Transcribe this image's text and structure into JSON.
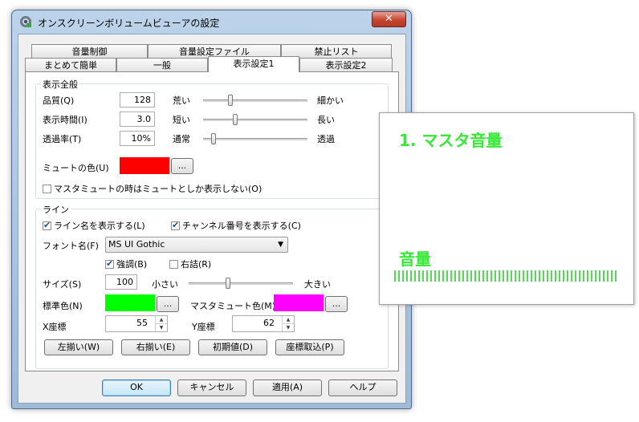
{
  "window": {
    "title": "オンスクリーンボリュームビューアの設定",
    "close_label": "✕"
  },
  "tabs": {
    "row1": [
      "音量制御",
      "音量設定ファイル",
      "禁止リスト"
    ],
    "row2": [
      "まとめて簡単",
      "一般",
      "表示設定1",
      "表示設定2"
    ],
    "active": "表示設定1"
  },
  "general": {
    "group_label": "表示全般",
    "quality": {
      "label": "品質(Q)",
      "value": "128",
      "low": "荒い",
      "high": "細かい",
      "level": 0.26
    },
    "display_time": {
      "label": "表示時間(I)",
      "value": "3.0",
      "low": "短い",
      "high": "長い",
      "level": 0.31
    },
    "transparency": {
      "label": "透過率(T)",
      "value": "10%",
      "low": "通常",
      "high": "透過",
      "level": 0.1
    },
    "mute_color": {
      "label": "ミュートの色(U)",
      "color": "#ff0000",
      "button": "..."
    },
    "master_mute_checkbox": {
      "label": "マスタミュートの時はミュートとしか表示しない(O)",
      "checked": false
    }
  },
  "line": {
    "group_label": "ライン",
    "show_line_name": {
      "label": "ライン名を表示する(L)",
      "checked": true
    },
    "show_channel_number": {
      "label": "チャンネル番号を表示する(C)",
      "checked": true
    },
    "font_name": {
      "label": "フォント名(F)",
      "value": "MS UI Gothic"
    },
    "bold": {
      "label": "強調(B)",
      "checked": true
    },
    "right_justify": {
      "label": "右詰(R)",
      "checked": false
    },
    "size": {
      "label": "サイズ(S)",
      "value": "100",
      "low": "小さい",
      "high": "大きい",
      "level": 0.38
    },
    "standard_color": {
      "label": "標準色(N)",
      "color": "#00ff00",
      "button": "..."
    },
    "master_mute_color": {
      "label": "マスタミュート色(M)",
      "color": "#ff00ff",
      "button": "..."
    },
    "x_coord": {
      "label": "X座標",
      "value": "55"
    },
    "y_coord": {
      "label": "Y座標",
      "value": "62"
    },
    "buttons": [
      "左揃い(W)",
      "右揃い(E)",
      "初期値(D)",
      "座標取込(P)"
    ]
  },
  "footer_buttons": {
    "ok": "OK",
    "cancel": "キャンセル",
    "apply": "適用(A)",
    "help": "ヘルプ"
  },
  "preview": {
    "title": "1. マスタ音量",
    "label": "音量",
    "accent": "#34e834"
  }
}
